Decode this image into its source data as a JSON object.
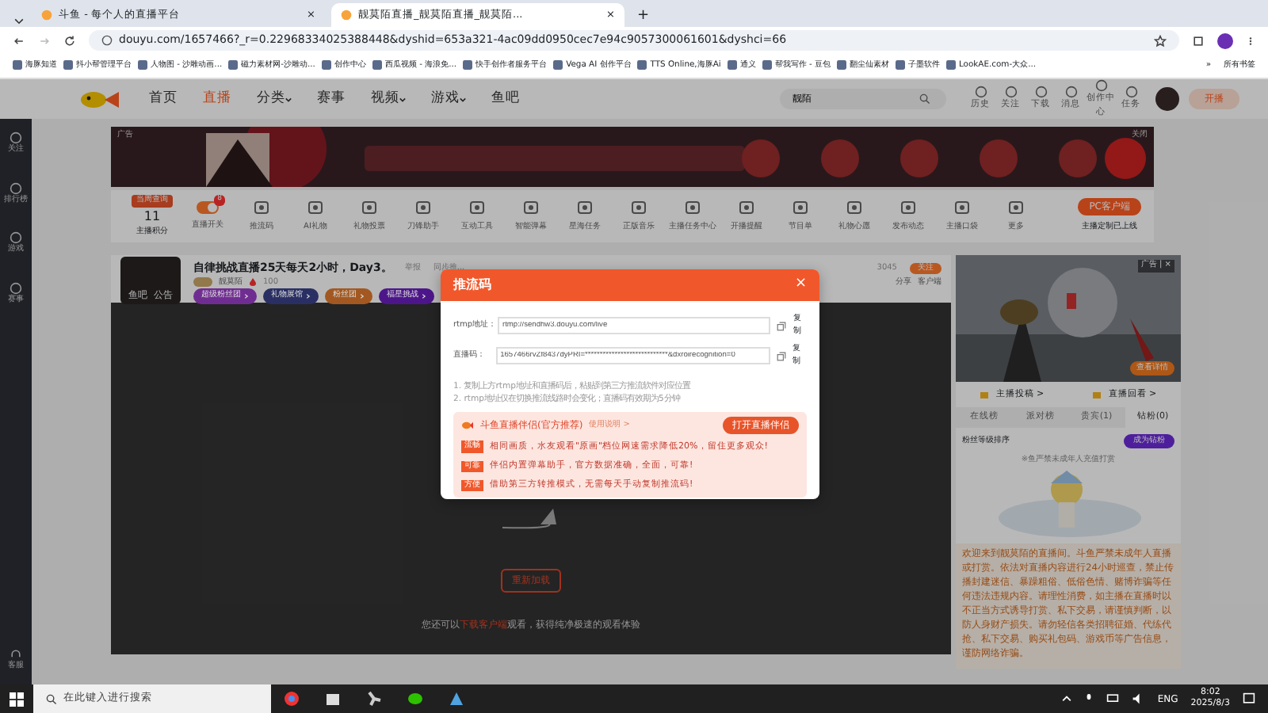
{
  "browser": {
    "tabs": [
      {
        "title": "斗鱼 - 每个人的直播平台",
        "selected": false
      },
      {
        "title": "靓莫陌直播_靓莫陌直播_靓莫陌...",
        "selected": true
      }
    ],
    "tab_close": "×",
    "new_tab": "+",
    "url": "douyu.com/1657466?_r=0.22968334025388448&dyshid=653a321-4ac09dd0950cec7e94c9057300061601&dyshci=66",
    "bookmarks": [
      "海豚知道",
      "抖小帮管理平台",
      "人物图 - 沙雕动画...",
      "磁力素材网-沙雕动...",
      "创作中心",
      "西瓜视频 - 海浪免...",
      "快手创作者服务平台",
      "Vega AI 创作平台",
      "TTS Online,海豚Ai",
      "通义",
      "帮我写作 - 豆包",
      "翻尘仙素材",
      "子墨软件",
      "LookAE.com-大众..."
    ],
    "bookmarks_more": "»",
    "all_bookmarks": "所有书签"
  },
  "header": {
    "nav": [
      {
        "label": "首页",
        "selected": false,
        "dropdown": false
      },
      {
        "label": "直播",
        "selected": true,
        "dropdown": false
      },
      {
        "label": "分类",
        "selected": false,
        "dropdown": true
      },
      {
        "label": "赛事",
        "selected": false,
        "dropdown": false
      },
      {
        "label": "视频",
        "selected": false,
        "dropdown": true
      },
      {
        "label": "游戏",
        "selected": false,
        "dropdown": true
      },
      {
        "label": "鱼吧",
        "selected": false,
        "dropdown": false
      }
    ],
    "search": {
      "value": "靓陌"
    },
    "shortcuts": [
      "历史",
      "关注",
      "下载",
      "消息",
      "创作中心",
      "任务"
    ],
    "start_button": "开播"
  },
  "sidebar": {
    "items": [
      "关注",
      "排行榜",
      "游戏",
      "赛事"
    ],
    "bottom": "客服"
  },
  "banner": {
    "ad_label": "广告",
    "close": "关闭"
  },
  "toolbar": {
    "tag": "当周查询",
    "score": "11",
    "score_label": "主播积分",
    "items": [
      {
        "label": "直播开关",
        "kind": "toggle",
        "on": true,
        "badge": "8"
      },
      {
        "label": "推流码",
        "kind": "icon"
      },
      {
        "label": "AI礼物",
        "kind": "icon"
      },
      {
        "label": "礼物投票",
        "kind": "icon"
      },
      {
        "label": "刀锋助手",
        "kind": "icon"
      },
      {
        "label": "互动工具",
        "kind": "icon"
      },
      {
        "label": "智能弹幕",
        "kind": "icon"
      },
      {
        "label": "星海任务",
        "kind": "icon"
      },
      {
        "label": "正版音乐",
        "kind": "icon"
      },
      {
        "label": "主播任务中心",
        "kind": "icon"
      },
      {
        "label": "开播提醒",
        "kind": "icon"
      },
      {
        "label": "节目单",
        "kind": "icon"
      },
      {
        "label": "礼物心愿",
        "kind": "icon"
      },
      {
        "label": "发布动态",
        "kind": "icon"
      },
      {
        "label": "主播口袋",
        "kind": "icon"
      },
      {
        "label": "更多",
        "kind": "icon"
      }
    ],
    "pc_button": "PC客户端",
    "pc_note": "主播定制已上线"
  },
  "room": {
    "title": "自律挑战直播25天每天2小时，Day3。",
    "report": "举报",
    "sync": "同步推...",
    "anchor": "靓莫陌",
    "heat": "100",
    "avatar_links": [
      "鱼吧",
      "公告"
    ],
    "tags": [
      {
        "label": "超级粉丝团",
        "color": "#702d91"
      },
      {
        "label": "礼物展馆",
        "color": "#2a2f63"
      },
      {
        "label": "粉丝团",
        "color": "#a25820"
      },
      {
        "label": "福星挑战",
        "color": "#4c168a"
      }
    ],
    "followers": "3045",
    "follow": "关注",
    "share": "分享",
    "client": "客户端"
  },
  "video": {
    "reload": "重新加载",
    "hint_before": "您还可以",
    "hint_link": "下载客户端",
    "hint_after": "观看，获得纯净极速的观看体验"
  },
  "side": {
    "ad_label": "广告 | ×",
    "details": "查看详情",
    "links": [
      "主播投稿 >",
      "直播回看 >"
    ],
    "rank_tabs": [
      {
        "label": "在线榜",
        "selected": false
      },
      {
        "label": "派对榜",
        "selected": false
      },
      {
        "label": "贵宾(1)",
        "selected": false
      },
      {
        "label": "钻粉(0)",
        "selected": true
      }
    ],
    "sort": "粉丝等级排序",
    "become": "成为钻粉",
    "rank_notice": "※鱼严禁未成年人充值打赏",
    "notice": "欢迎来到靓莫陌的直播间。斗鱼严禁未成年人直播或打赏。依法对直播内容进行24小时巡查，禁止传播封建迷信、暴躁粗俗、低俗色情、赌博诈骗等任何违法违规内容。请理性消费，如主播在直播时以不正当方式诱导打赏、私下交易，请谨慎判断，以防人身财产损失。请勿轻信各类招聘征婚、代练代抢、私下交易、购买礼包码、游戏币等广告信息，谨防网络诈骗。"
  },
  "modal": {
    "title": "推流码",
    "close": "×",
    "fields": [
      {
        "label": "rtmp地址：",
        "value": "rtmp://sendhw3.douyu.com/live",
        "copy": "复制"
      },
      {
        "label": "直播码：",
        "value": "1657466rvZf8437dyPRI=****************************&dxroirecognition=0",
        "copy": "复制"
      }
    ],
    "notes": [
      "1. 复制上方rtmp地址和直播码后，粘贴到第三方推流软件对应位置",
      "2. rtmp地址仅在切换推流线路时会变化；直播码有效期为5分钟"
    ],
    "promo": {
      "title": "斗鱼直播伴侣(官方推荐)",
      "help": "使用说明 >",
      "button": "打开直播伴侣",
      "features": [
        {
          "tag": "流畅",
          "text": "相同画质，水友观看\"原画\"档位网速需求降低20%，留住更多观众!"
        },
        {
          "tag": "可靠",
          "text": "伴侣内置弹幕助手，官方数据准确，全面，可靠!"
        },
        {
          "tag": "方便",
          "text": "借助第三方转推模式，无需每天手动复制推流码!"
        }
      ]
    }
  },
  "taskbar": {
    "search": "在此键入进行搜索",
    "lang": "ENG",
    "time": "8:02",
    "date": "2025/8/3"
  }
}
